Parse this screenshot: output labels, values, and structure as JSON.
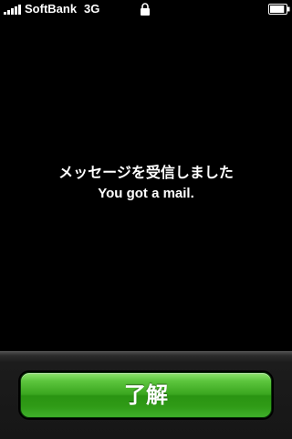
{
  "status_bar": {
    "carrier": "SoftBank",
    "network": "3G",
    "signal_icon": "signal-bars-icon",
    "lock_icon": "lock-icon",
    "battery_icon": "battery-icon",
    "battery_level": 0.9
  },
  "alert": {
    "message_jp": "メッセージを受信しました",
    "message_en": "You got a mail."
  },
  "actions": {
    "ok_label": "了解"
  },
  "colors": {
    "background": "#000000",
    "button_green": "#3aa61f",
    "text": "#ffffff"
  }
}
